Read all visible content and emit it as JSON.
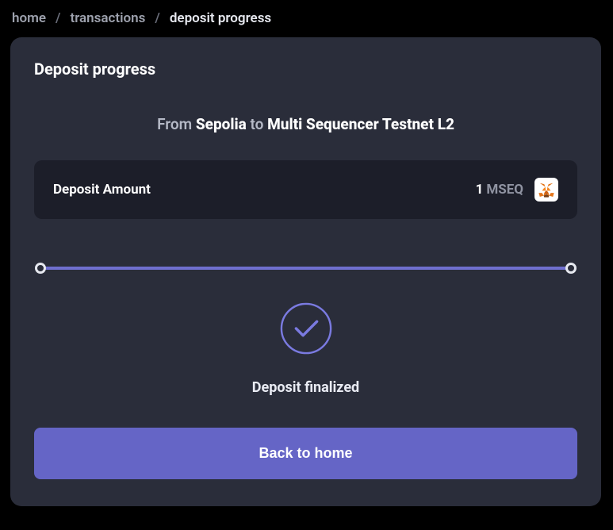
{
  "breadcrumb": {
    "items": [
      {
        "label": "home",
        "current": false
      },
      {
        "label": "transactions",
        "current": false
      },
      {
        "label": "deposit progress",
        "current": true
      }
    ],
    "separator": "/"
  },
  "card": {
    "title": "Deposit progress",
    "route": {
      "from_label": "From",
      "from_chain": "Sepolia",
      "to_label": "to",
      "to_chain": "Multi Sequencer Testnet L2"
    },
    "amount": {
      "label": "Deposit Amount",
      "value": "1",
      "symbol": "MSEQ",
      "token_icon": "metamask-fox-icon"
    },
    "progress": {
      "steps": 2,
      "completed": 2
    },
    "status": {
      "icon": "check-circle-icon",
      "text": "Deposit finalized"
    },
    "cta": {
      "label": "Back to home"
    }
  },
  "colors": {
    "accent": "#6565c6",
    "cardBg": "#2a2d3a",
    "rowBg": "#1c1e29",
    "muted": "#9da1ad"
  }
}
